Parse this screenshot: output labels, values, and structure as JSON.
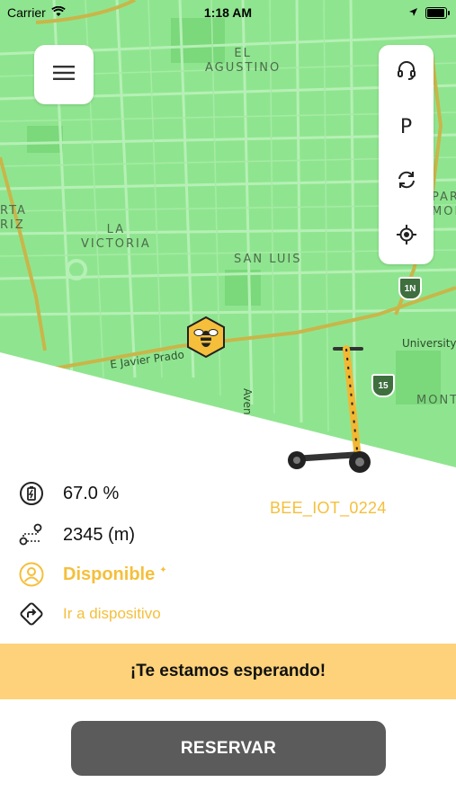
{
  "status_bar": {
    "carrier": "Carrier",
    "time": "1:18 AM"
  },
  "map": {
    "district_labels": [
      "EL\nAGUSTINO",
      "LA\nVICTORIA",
      "SAN LUIS",
      "RTA\nRIZ",
      "PAR\nMON",
      "University",
      "MONT"
    ],
    "street_labels": [
      "E Javier Prado",
      "Avenida"
    ],
    "highway_shields": [
      "1N",
      "15"
    ],
    "colors": {
      "land": "#8fe58f",
      "road": "#b6f0b6",
      "highway": "#c9b64a",
      "park": "#7bd87b"
    }
  },
  "side_controls": {
    "parking_label": "P"
  },
  "details": {
    "battery_text": "67.0 %",
    "distance_text": "2345 (m)",
    "status_text": "Disponible",
    "navigate_text": "Ir a dispositivo",
    "device_name": "BEE_IOT_0224"
  },
  "banner": {
    "text": "¡Te estamos esperando!"
  },
  "reserve_button": {
    "label": "RESERVAR"
  },
  "colors": {
    "accent": "#f5bf3b",
    "banner": "#fdd27a",
    "button": "#5b5b5b"
  }
}
